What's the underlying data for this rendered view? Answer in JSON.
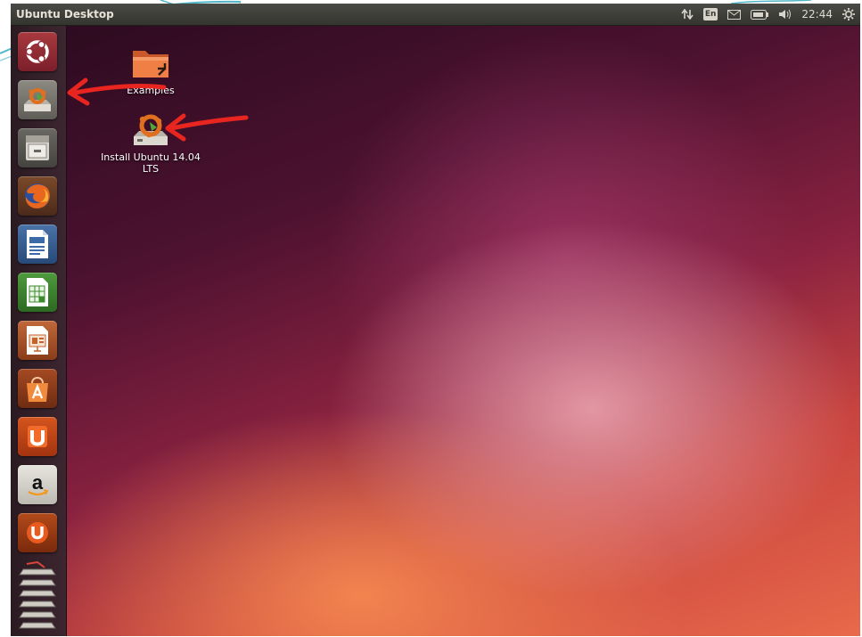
{
  "topbar": {
    "title": "Ubuntu Desktop",
    "keyboard_layout": "En",
    "clock": "22:44",
    "icons": [
      "network-arrows-icon",
      "keyboard-layout-icon",
      "mail-icon",
      "battery-icon",
      "volume-icon",
      "gear-icon"
    ]
  },
  "launcher": {
    "items": [
      {
        "name": "dash-home",
        "icon": "ubuntu-logo-icon"
      },
      {
        "name": "install-ubuntu",
        "icon": "installer-icon"
      },
      {
        "name": "files",
        "icon": "file-cabinet-icon"
      },
      {
        "name": "firefox",
        "icon": "firefox-icon"
      },
      {
        "name": "libreoffice-writer",
        "icon": "writer-document-icon"
      },
      {
        "name": "libreoffice-calc",
        "icon": "calc-spreadsheet-icon"
      },
      {
        "name": "libreoffice-impress",
        "icon": "impress-presentation-icon"
      },
      {
        "name": "software-center",
        "icon": "shopping-bag-icon"
      },
      {
        "name": "ubuntu-one",
        "icon": "ubuntu-one-icon"
      },
      {
        "name": "amazon",
        "icon": "amazon-icon"
      },
      {
        "name": "ubuntu-one-music",
        "icon": "ubuntu-one-music-icon"
      },
      {
        "name": "workspace-switcher",
        "icon": "workspace-stack-icon"
      }
    ]
  },
  "desktop": {
    "icons": [
      {
        "label": "Examples",
        "icon": "folder-link-icon"
      },
      {
        "label_line1": "Install Ubuntu 14.04",
        "label_line2": "LTS",
        "icon": "installer-icon"
      }
    ]
  },
  "annotations": {
    "arrow_color": "#e8251f"
  },
  "colors": {
    "topbar": "#3c3b37",
    "launcher": "#33212a",
    "desktop_dark": "#2d0b20",
    "desktop_orange": "#e8694a"
  }
}
